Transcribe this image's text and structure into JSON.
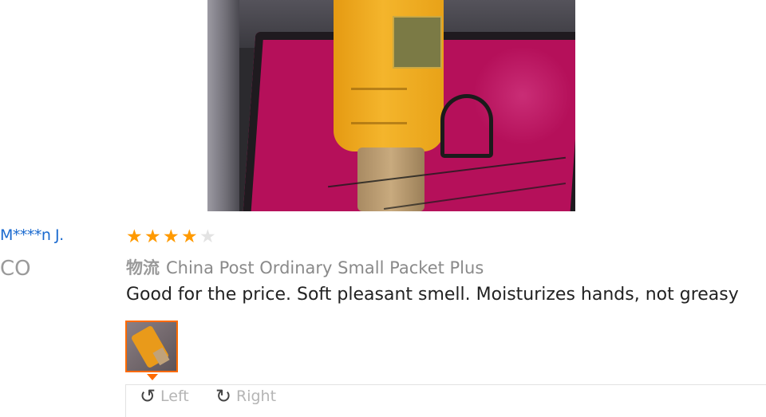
{
  "reviewer": {
    "name": "M****n J.",
    "country": "CO"
  },
  "review": {
    "rating": 4,
    "rating_max": 5,
    "shipping_label": "物流",
    "shipping_method": "China Post Ordinary Small Packet Plus",
    "feedback": "Good for the price. Soft pleasant smell. Moisturizes hands, not greasy"
  },
  "viewer": {
    "rotate_left_label": "Left",
    "rotate_right_label": "Right"
  },
  "icons": {
    "star": "star-icon",
    "rotate_left": "rotate-left-icon",
    "rotate_right": "rotate-right-icon"
  },
  "colors": {
    "reviewer_name": "#1a6acf",
    "star_filled": "#ff9a00",
    "star_empty": "#e3e3e3",
    "thumb_border": "#ff6a00"
  }
}
